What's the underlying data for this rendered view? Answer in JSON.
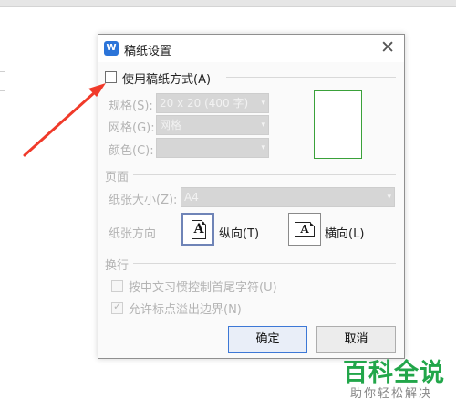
{
  "window": {
    "title": "稿纸设置",
    "app_icon": "W",
    "close_glyph": "✕"
  },
  "use_mode": {
    "label": "使用稿纸方式(A)",
    "checked": false
  },
  "spec": {
    "label": "规格(S):",
    "value": "20 x 20 (400 字)"
  },
  "grid": {
    "label": "网格(G):",
    "value": "网格"
  },
  "color": {
    "label": "颜色(C):",
    "value": ""
  },
  "page": {
    "section_label": "页面",
    "size_label": "纸张大小(Z):",
    "size_value": "A4",
    "orientation_label": "纸张方向",
    "portrait_label": "纵向(T)",
    "landscape_label": "横向(L)",
    "orientation_glyph": "A"
  },
  "line_break": {
    "section_label": "换行",
    "option1": {
      "label": "按中文习惯控制首尾字符(U)",
      "checked": false
    },
    "option2": {
      "label": "允许标点溢出边界(N)",
      "checked": true
    }
  },
  "buttons": {
    "ok": "确定",
    "cancel": "取消"
  },
  "watermark": {
    "title": "百科全说",
    "subtitle": "助你轻松解决"
  },
  "colors": {
    "accent": "#3d78d6",
    "preview_border": "#3aa13a",
    "annotation": "#f03a2a",
    "watermark": "#22a64a"
  }
}
